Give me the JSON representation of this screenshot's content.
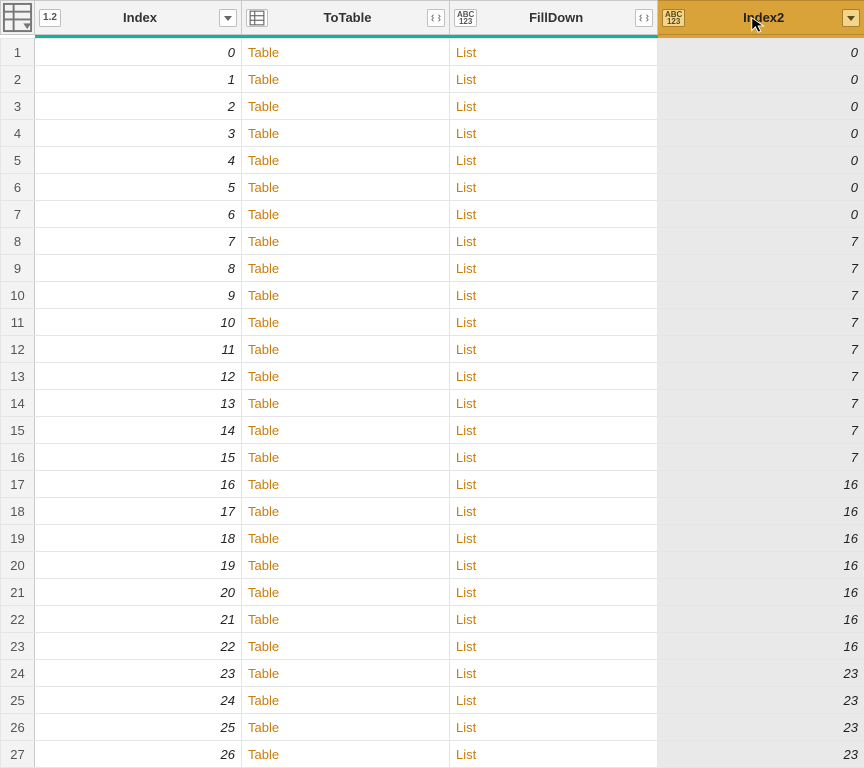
{
  "columns": {
    "index": {
      "name": "Index",
      "type_label": "1.2",
      "has_expand": false,
      "selected": false
    },
    "totable": {
      "name": "ToTable",
      "type_label": "tbl",
      "has_expand": true,
      "selected": false
    },
    "filldown": {
      "name": "FillDown",
      "type_label": "ABC123",
      "has_expand": true,
      "selected": false
    },
    "index2": {
      "name": "Index2",
      "type_label": "ABC123",
      "has_expand": false,
      "selected": true
    }
  },
  "link_text": {
    "table": "Table",
    "list": "List"
  },
  "rows": [
    {
      "n": 1,
      "index": 0,
      "totable": "table",
      "filldown": "list",
      "index2": 0
    },
    {
      "n": 2,
      "index": 1,
      "totable": "table",
      "filldown": "list",
      "index2": 0
    },
    {
      "n": 3,
      "index": 2,
      "totable": "table",
      "filldown": "list",
      "index2": 0
    },
    {
      "n": 4,
      "index": 3,
      "totable": "table",
      "filldown": "list",
      "index2": 0
    },
    {
      "n": 5,
      "index": 4,
      "totable": "table",
      "filldown": "list",
      "index2": 0
    },
    {
      "n": 6,
      "index": 5,
      "totable": "table",
      "filldown": "list",
      "index2": 0
    },
    {
      "n": 7,
      "index": 6,
      "totable": "table",
      "filldown": "list",
      "index2": 0
    },
    {
      "n": 8,
      "index": 7,
      "totable": "table",
      "filldown": "list",
      "index2": 7
    },
    {
      "n": 9,
      "index": 8,
      "totable": "table",
      "filldown": "list",
      "index2": 7
    },
    {
      "n": 10,
      "index": 9,
      "totable": "table",
      "filldown": "list",
      "index2": 7
    },
    {
      "n": 11,
      "index": 10,
      "totable": "table",
      "filldown": "list",
      "index2": 7
    },
    {
      "n": 12,
      "index": 11,
      "totable": "table",
      "filldown": "list",
      "index2": 7
    },
    {
      "n": 13,
      "index": 12,
      "totable": "table",
      "filldown": "list",
      "index2": 7
    },
    {
      "n": 14,
      "index": 13,
      "totable": "table",
      "filldown": "list",
      "index2": 7
    },
    {
      "n": 15,
      "index": 14,
      "totable": "table",
      "filldown": "list",
      "index2": 7
    },
    {
      "n": 16,
      "index": 15,
      "totable": "table",
      "filldown": "list",
      "index2": 7
    },
    {
      "n": 17,
      "index": 16,
      "totable": "table",
      "filldown": "list",
      "index2": 16
    },
    {
      "n": 18,
      "index": 17,
      "totable": "table",
      "filldown": "list",
      "index2": 16
    },
    {
      "n": 19,
      "index": 18,
      "totable": "table",
      "filldown": "list",
      "index2": 16
    },
    {
      "n": 20,
      "index": 19,
      "totable": "table",
      "filldown": "list",
      "index2": 16
    },
    {
      "n": 21,
      "index": 20,
      "totable": "table",
      "filldown": "list",
      "index2": 16
    },
    {
      "n": 22,
      "index": 21,
      "totable": "table",
      "filldown": "list",
      "index2": 16
    },
    {
      "n": 23,
      "index": 22,
      "totable": "table",
      "filldown": "list",
      "index2": 16
    },
    {
      "n": 24,
      "index": 23,
      "totable": "table",
      "filldown": "list",
      "index2": 23
    },
    {
      "n": 25,
      "index": 24,
      "totable": "table",
      "filldown": "list",
      "index2": 23
    },
    {
      "n": 26,
      "index": 25,
      "totable": "table",
      "filldown": "list",
      "index2": 23
    },
    {
      "n": 27,
      "index": 26,
      "totable": "table",
      "filldown": "list",
      "index2": 23
    }
  ]
}
